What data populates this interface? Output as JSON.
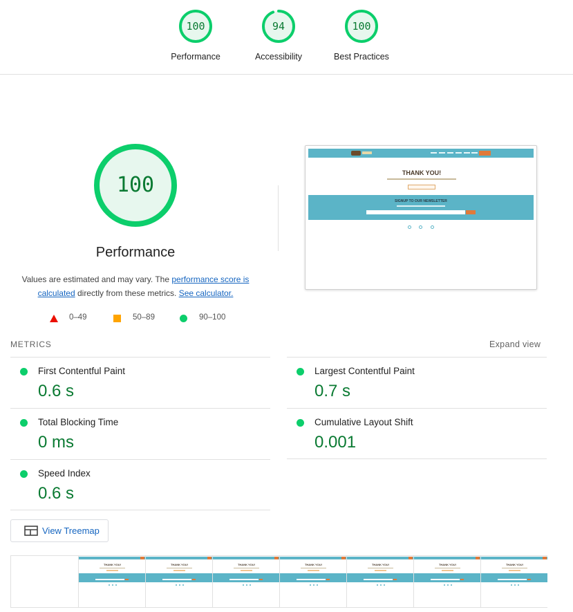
{
  "gauges": [
    {
      "score": "100",
      "label": "Performance",
      "fraction": 1.0,
      "color": "#0cce6b"
    },
    {
      "score": "94",
      "label": "Accessibility",
      "fraction": 0.94,
      "color": "#0cce6b"
    },
    {
      "score": "100",
      "label": "Best Practices",
      "fraction": 1.0,
      "color": "#0cce6b"
    }
  ],
  "performance": {
    "score": "100",
    "fraction": 1.0,
    "title": "Performance",
    "desc_prefix": "Values are estimated and may vary. The ",
    "desc_link1": "performance score is calculated",
    "desc_middle": " directly from these metrics. ",
    "desc_link2": "See calculator."
  },
  "legend": {
    "fail": "0–49",
    "average": "50–89",
    "pass": "90–100",
    "colors": {
      "fail": "#eb0f00",
      "average": "#ffa400",
      "pass": "#0cce6b"
    }
  },
  "screenshot": {
    "heading": "THANK YOU!",
    "newsletter_heading": "SIGNUP TO OUR NEWSLETTER"
  },
  "metrics": {
    "header": "METRICS",
    "expand_label": "Expand view",
    "items": [
      {
        "name": "First Contentful Paint",
        "value": "0.6 s"
      },
      {
        "name": "Largest Contentful Paint",
        "value": "0.7 s"
      },
      {
        "name": "Total Blocking Time",
        "value": "0 ms"
      },
      {
        "name": "Cumulative Layout Shift",
        "value": "0.001"
      },
      {
        "name": "Speed Index",
        "value": "0.6 s"
      }
    ]
  },
  "treemap": {
    "label": "View Treemap"
  },
  "filmstrip": {
    "frame_heading": "THANK YOU!"
  }
}
